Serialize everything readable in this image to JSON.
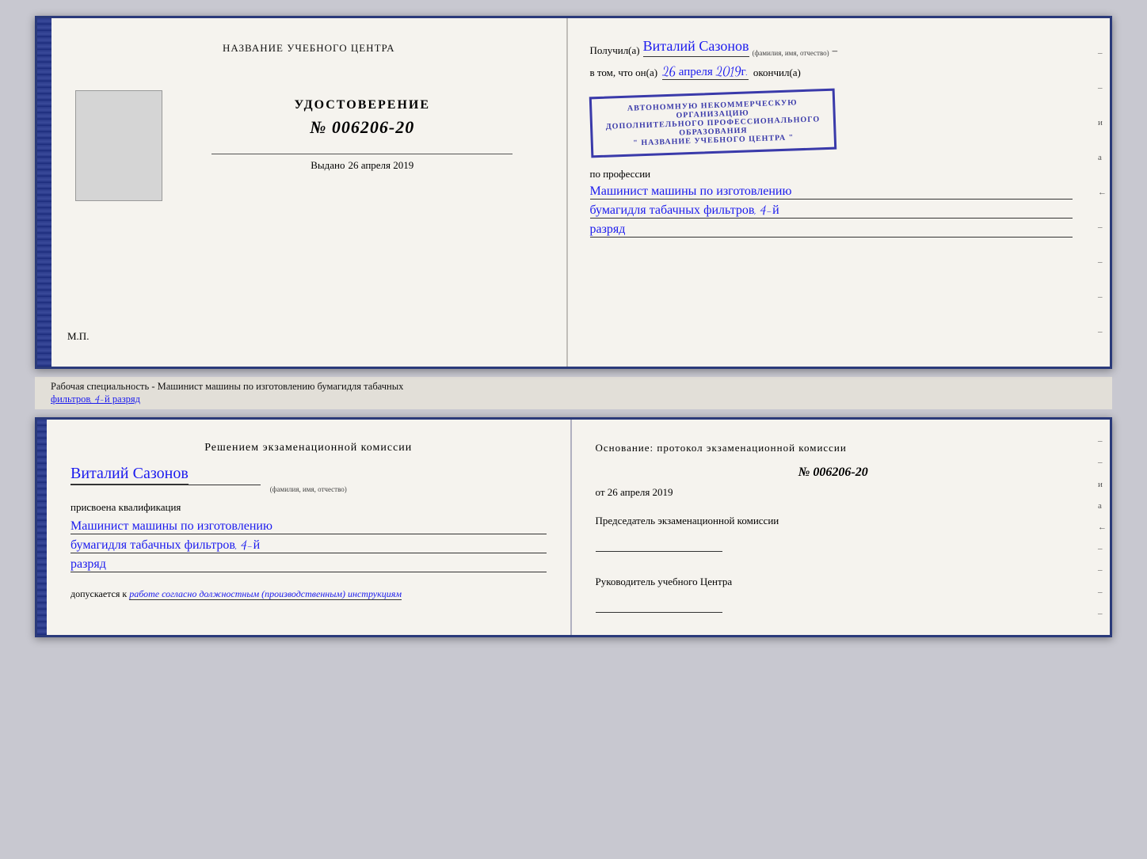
{
  "top_document": {
    "left_page": {
      "training_center_label": "НАЗВАНИЕ УЧЕБНОГО ЦЕНТРА",
      "cert_title": "УДОСТОВЕРЕНИЕ",
      "cert_number": "№ 006206-20",
      "issued_label": "Выдано",
      "issued_date": "26 апреля 2019",
      "mp_label": "М.П."
    },
    "right_page": {
      "received_prefix": "Получил(а)",
      "recipient_name": "Виталий Сазонов",
      "fio_caption": "(фамилия, имя, отчество)",
      "in_that_prefix": "в том, что он(а)",
      "completion_date": "26 апреля 2019г.",
      "finished_label": "окончил(а)",
      "stamp_line1": "АВТОНОМНУЮ НЕКОММЕРЧЕСКУЮ ОРГАНИЗАЦИЮ",
      "stamp_line2": "ДОПОЛНИТЕЛЬНОГО ПРОФЕССИОНАЛЬНОГО ОБРАЗОВАНИЯ",
      "stamp_line3": "\" НАЗВАНИЕ УЧЕБНОГО ЦЕНТРА \"",
      "profession_label": "по профессии",
      "profession_line1": "Машинист машины по изготовлению",
      "profession_line2": "бумагидля табачных фильтров, 4-й",
      "profession_line3": "разряд"
    }
  },
  "middle_bar": {
    "text": "Рабочая специальность - Машинист машины по изготовлению бумагидля табачных",
    "text2": "фильтров, 4-й разряд"
  },
  "bottom_document": {
    "left_page": {
      "decision_title": "Решением экзаменационной комиссии",
      "person_name": "Виталий Сазонов",
      "fio_caption": "(фамилия, имя, отчество)",
      "assigned_text": "присвоена квалификация",
      "qualification_line1": "Машинист машины по изготовлению",
      "qualification_line2": "бумагидля табачных фильтров, 4-й",
      "qualification_line3": "разряд",
      "allows_prefix": "допускается к",
      "allows_text": "работе согласно должностным (производственным) инструкциям"
    },
    "right_page": {
      "basis_title": "Основание: протокол экзаменационной комиссии",
      "protocol_number": "№ 006206-20",
      "from_prefix": "от",
      "protocol_date": "26 апреля 2019",
      "chairman_title": "Председатель экзаменационной комиссии",
      "center_head_title": "Руководитель учебного Центра"
    }
  },
  "edge_marks": [
    "–",
    "–",
    "и",
    "а",
    "←",
    "–",
    "–",
    "–",
    "–"
  ]
}
